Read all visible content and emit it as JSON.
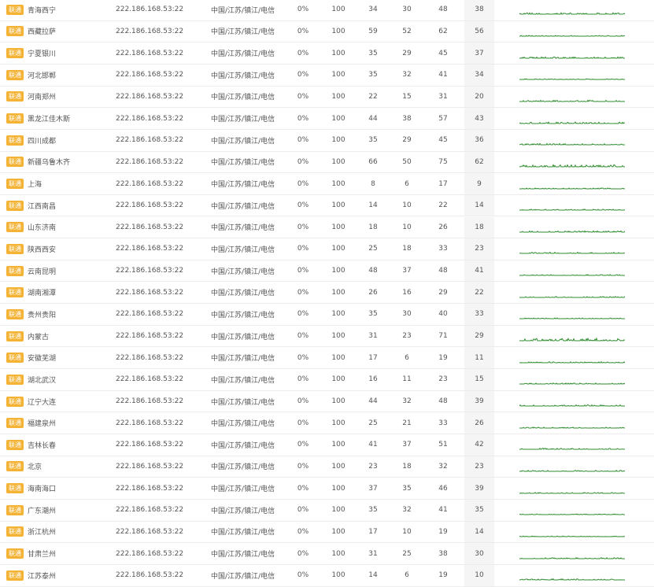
{
  "rows": [
    {
      "isp": "联通",
      "node": "青海西宁",
      "ip": "222.186.168.53:22",
      "loc": "中国/江苏/镇江/电信",
      "loss": "0%",
      "sent": "100",
      "last": "34",
      "min": "30",
      "max": "48",
      "avg": "38"
    },
    {
      "isp": "联通",
      "node": "西藏拉萨",
      "ip": "222.186.168.53:22",
      "loc": "中国/江苏/镇江/电信",
      "loss": "0%",
      "sent": "100",
      "last": "59",
      "min": "52",
      "max": "62",
      "avg": "56"
    },
    {
      "isp": "联通",
      "node": "宁夏银川",
      "ip": "222.186.168.53:22",
      "loc": "中国/江苏/镇江/电信",
      "loss": "0%",
      "sent": "100",
      "last": "35",
      "min": "29",
      "max": "45",
      "avg": "37"
    },
    {
      "isp": "联通",
      "node": "河北邯郸",
      "ip": "222.186.168.53:22",
      "loc": "中国/江苏/镇江/电信",
      "loss": "0%",
      "sent": "100",
      "last": "35",
      "min": "32",
      "max": "41",
      "avg": "34"
    },
    {
      "isp": "联通",
      "node": "河南郑州",
      "ip": "222.186.168.53:22",
      "loc": "中国/江苏/镇江/电信",
      "loss": "0%",
      "sent": "100",
      "last": "22",
      "min": "15",
      "max": "31",
      "avg": "20"
    },
    {
      "isp": "联通",
      "node": "黑龙江佳木斯",
      "ip": "222.186.168.53:22",
      "loc": "中国/江苏/镇江/电信",
      "loss": "0%",
      "sent": "100",
      "last": "44",
      "min": "38",
      "max": "57",
      "avg": "43"
    },
    {
      "isp": "联通",
      "node": "四川成都",
      "ip": "222.186.168.53:22",
      "loc": "中国/江苏/镇江/电信",
      "loss": "0%",
      "sent": "100",
      "last": "35",
      "min": "29",
      "max": "45",
      "avg": "36"
    },
    {
      "isp": "联通",
      "node": "新疆乌鲁木齐",
      "ip": "222.186.168.53:22",
      "loc": "中国/江苏/镇江/电信",
      "loss": "0%",
      "sent": "100",
      "last": "66",
      "min": "50",
      "max": "75",
      "avg": "62"
    },
    {
      "isp": "联通",
      "node": "上海",
      "ip": "222.186.168.53:22",
      "loc": "中国/江苏/镇江/电信",
      "loss": "0%",
      "sent": "100",
      "last": "8",
      "min": "6",
      "max": "17",
      "avg": "9"
    },
    {
      "isp": "联通",
      "node": "江西南昌",
      "ip": "222.186.168.53:22",
      "loc": "中国/江苏/镇江/电信",
      "loss": "0%",
      "sent": "100",
      "last": "14",
      "min": "10",
      "max": "22",
      "avg": "14"
    },
    {
      "isp": "联通",
      "node": "山东济南",
      "ip": "222.186.168.53:22",
      "loc": "中国/江苏/镇江/电信",
      "loss": "0%",
      "sent": "100",
      "last": "18",
      "min": "10",
      "max": "26",
      "avg": "18"
    },
    {
      "isp": "联通",
      "node": "陕西西安",
      "ip": "222.186.168.53:22",
      "loc": "中国/江苏/镇江/电信",
      "loss": "0%",
      "sent": "100",
      "last": "25",
      "min": "18",
      "max": "33",
      "avg": "23"
    },
    {
      "isp": "联通",
      "node": "云南昆明",
      "ip": "222.186.168.53:22",
      "loc": "中国/江苏/镇江/电信",
      "loss": "0%",
      "sent": "100",
      "last": "48",
      "min": "37",
      "max": "48",
      "avg": "41"
    },
    {
      "isp": "联通",
      "node": "湖南湘潭",
      "ip": "222.186.168.53:22",
      "loc": "中国/江苏/镇江/电信",
      "loss": "0%",
      "sent": "100",
      "last": "26",
      "min": "16",
      "max": "29",
      "avg": "22"
    },
    {
      "isp": "联通",
      "node": "贵州贵阳",
      "ip": "222.186.168.53:22",
      "loc": "中国/江苏/镇江/电信",
      "loss": "0%",
      "sent": "100",
      "last": "35",
      "min": "30",
      "max": "40",
      "avg": "33"
    },
    {
      "isp": "联通",
      "node": "内蒙古",
      "ip": "222.186.168.53:22",
      "loc": "中国/江苏/镇江/电信",
      "loss": "0%",
      "sent": "100",
      "last": "31",
      "min": "23",
      "max": "71",
      "avg": "29"
    },
    {
      "isp": "联通",
      "node": "安徽芜湖",
      "ip": "222.186.168.53:22",
      "loc": "中国/江苏/镇江/电信",
      "loss": "0%",
      "sent": "100",
      "last": "17",
      "min": "6",
      "max": "19",
      "avg": "11"
    },
    {
      "isp": "联通",
      "node": "湖北武汉",
      "ip": "222.186.168.53:22",
      "loc": "中国/江苏/镇江/电信",
      "loss": "0%",
      "sent": "100",
      "last": "16",
      "min": "11",
      "max": "23",
      "avg": "15"
    },
    {
      "isp": "联通",
      "node": "辽宁大连",
      "ip": "222.186.168.53:22",
      "loc": "中国/江苏/镇江/电信",
      "loss": "0%",
      "sent": "100",
      "last": "44",
      "min": "32",
      "max": "48",
      "avg": "39"
    },
    {
      "isp": "联通",
      "node": "福建泉州",
      "ip": "222.186.168.53:22",
      "loc": "中国/江苏/镇江/电信",
      "loss": "0%",
      "sent": "100",
      "last": "25",
      "min": "21",
      "max": "33",
      "avg": "26"
    },
    {
      "isp": "联通",
      "node": "吉林长春",
      "ip": "222.186.168.53:22",
      "loc": "中国/江苏/镇江/电信",
      "loss": "0%",
      "sent": "100",
      "last": "41",
      "min": "37",
      "max": "51",
      "avg": "42"
    },
    {
      "isp": "联通",
      "node": "北京",
      "ip": "222.186.168.53:22",
      "loc": "中国/江苏/镇江/电信",
      "loss": "0%",
      "sent": "100",
      "last": "23",
      "min": "18",
      "max": "32",
      "avg": "23"
    },
    {
      "isp": "联通",
      "node": "海南海口",
      "ip": "222.186.168.53:22",
      "loc": "中国/江苏/镇江/电信",
      "loss": "0%",
      "sent": "100",
      "last": "37",
      "min": "35",
      "max": "46",
      "avg": "39"
    },
    {
      "isp": "联通",
      "node": "广东潮州",
      "ip": "222.186.168.53:22",
      "loc": "中国/江苏/镇江/电信",
      "loss": "0%",
      "sent": "100",
      "last": "35",
      "min": "32",
      "max": "41",
      "avg": "35"
    },
    {
      "isp": "联通",
      "node": "浙江杭州",
      "ip": "222.186.168.53:22",
      "loc": "中国/江苏/镇江/电信",
      "loss": "0%",
      "sent": "100",
      "last": "17",
      "min": "10",
      "max": "19",
      "avg": "14"
    },
    {
      "isp": "联通",
      "node": "甘肃兰州",
      "ip": "222.186.168.53:22",
      "loc": "中国/江苏/镇江/电信",
      "loss": "0%",
      "sent": "100",
      "last": "31",
      "min": "25",
      "max": "38",
      "avg": "30"
    },
    {
      "isp": "联通",
      "node": "江苏泰州",
      "ip": "222.186.168.53:22",
      "loc": "中国/江苏/镇江/电信",
      "loss": "0%",
      "sent": "100",
      "last": "14",
      "min": "6",
      "max": "19",
      "avg": "10"
    }
  ],
  "colors": {
    "isp_badge": "#f5b335",
    "sparkline": "#2e8b2e",
    "avg_bg": "#f5f5f5"
  }
}
